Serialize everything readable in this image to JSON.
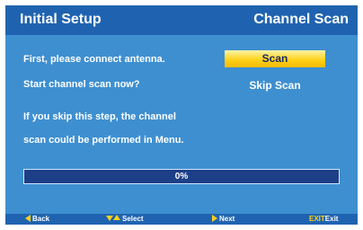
{
  "header": {
    "title": "Initial Setup",
    "section": "Channel Scan"
  },
  "instructions": {
    "line1": "First, please connect antenna.",
    "line2": "Start channel scan now?",
    "note_line1": "If you skip this step, the channel",
    "note_line2": "scan could be performed in Menu."
  },
  "options": {
    "scan_label": "Scan",
    "skip_label": "Skip Scan",
    "selected": "Scan"
  },
  "progress": {
    "value": 0,
    "label": "0%"
  },
  "footer": {
    "back_label": "Back",
    "select_label": "Select",
    "next_label": "Next",
    "exit_key": "EXIT",
    "exit_label": "Exit"
  },
  "colors": {
    "background": "#3e8fd0",
    "header_bar": "#1f63b0",
    "highlight": "#ffd21a",
    "progress_track": "#1c3f88"
  },
  "icons": {
    "back": "triangle-left-icon",
    "select_down": "triangle-down-icon",
    "select_up": "triangle-up-icon",
    "next": "triangle-right-icon"
  }
}
